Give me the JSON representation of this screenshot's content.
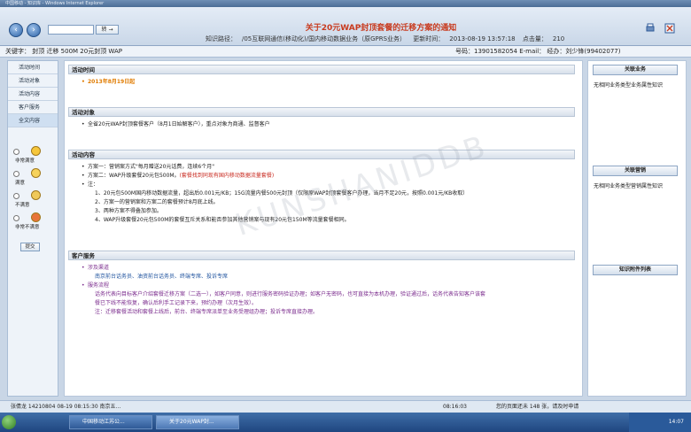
{
  "window": {
    "title": "中国移动 - 知识库 - Windows Internet Explorer"
  },
  "toolbar": {
    "go_label": "转 →",
    "page_title": "关于20元WAP封顶套餐的迁移方案的通知",
    "path_label": "知识路径：",
    "path_value": "/05互联网通信(移动化)/国内移动数据业务（原GPRS业务）",
    "update_label": "更新时间：",
    "update_value": "2013-08-19 13:57:18",
    "hits_label": "点击量：",
    "hits_value": "210"
  },
  "subheader": {
    "keywords": "关键字： 封顶 迁移 500M 20元封顶 WAP",
    "account": "号码：13901582054 E-mail： 经办：刘少锋(99402077)"
  },
  "leftnav": {
    "items": [
      "活动时间",
      "活动对象",
      "活动内容",
      "客户服务",
      "全文内容"
    ],
    "ratings": [
      "非常满意",
      "满意",
      "不满意",
      "非常不满意"
    ],
    "submit": "提交"
  },
  "sections": {
    "time": {
      "heading": "活动时间",
      "text": "2013年8月19日起"
    },
    "target": {
      "heading": "活动对象",
      "text": "全省20元WAP封顶套餐客户（8月1日始解客户），重点对象为商通、监督客户"
    },
    "content": {
      "heading": "活动内容",
      "p1": "方案一：营销案方式\"每月赠送20元话费，连续6个月\"",
      "p2a": "方案二：WAP升级套餐20元包500M。",
      "p2b": "(套餐找到同现有国内移动数据流量套餐)",
      "note": "注：",
      "n1": "1、20元包500M国内移动数据流量，超出后0.001元/KB；15G流量内餐500元封顶（仅限原WAP封顶套餐客户办理，当月不足20元，按照0.001元/KB收取）",
      "n2": "2、方案一的营销案和方案二的套餐预计8月底上线。",
      "n3": "3、两种方案不得叠加参加。",
      "n4": "4、WAP升级套餐20元包500M的套餐互斥关系和能否参加其他营销案与现有20元包150M等流量套餐相同。"
    },
    "service": {
      "heading": "客户服务",
      "channels_label": "涉及渠道",
      "channels_value": "南京前台话务员、油资前台话务员、终端专席、投诉专席",
      "process_label": "服务流程",
      "s1": "话务代表向目标客户介绍套餐迁移方案（二选一），如客户同意，则进行服务密码验证办理；如客户无密码，也可直接为本机办理，验证通过后，话务代表告知客户该套",
      "s1b": "餐已下线不能恢复，确认后利手工记录下来，预约办理（次月生效）。",
      "s2": "注：迁移套餐活动和套餐上线后，前台、终端专席派单至业务受理组办理；投诉专席直接办理。"
    }
  },
  "sidebar": {
    "related_business": "关联业务",
    "related_business_text": "无相同业务类型业务属性知识",
    "related_marketing": "关联营销",
    "related_marketing_text": "无相同业务类型营销属性知识",
    "attachments": "知识附件列表"
  },
  "watermark": "KUNSHANIDDB",
  "statusbar": {
    "user": "张倩龙 14210804   08-19 08:15:30 南京五...",
    "time": "08:16:03",
    "message": "您的页面还未 148 张，请及时申请"
  },
  "taskbar": {
    "tasks": [
      "中国移动江苏公...",
      "关于20元WAP封..."
    ],
    "clock": "14:07"
  },
  "colors": {
    "title_red": "#c83a1e",
    "date_orange": "#e07b00",
    "taskbar_blue": "#2a5a9a"
  }
}
